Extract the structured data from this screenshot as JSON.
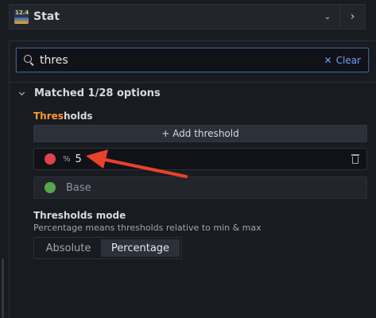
{
  "viz_picker": {
    "badge": "12.4",
    "name": "Stat",
    "dropdown_icon": "chevron-down-icon",
    "next_icon": "chevron-right-icon"
  },
  "search": {
    "value": "thres",
    "clear_label": "Clear"
  },
  "section": {
    "title": "Matched 1/28 options"
  },
  "thresholds": {
    "label_highlight": "Thres",
    "label_rest": "holds",
    "add_button": "+ Add threshold",
    "rows": [
      {
        "color": "#e0424f",
        "prefix": "%",
        "value": "5"
      },
      {
        "color": "#56a64b",
        "label": "Base"
      }
    ]
  },
  "mode": {
    "label": "Thresholds mode",
    "description": "Percentage means thresholds relative to min & max",
    "options": [
      "Absolute",
      "Percentage"
    ],
    "selected": "Percentage"
  },
  "annotation": {
    "arrow_color": "#e8412c"
  }
}
